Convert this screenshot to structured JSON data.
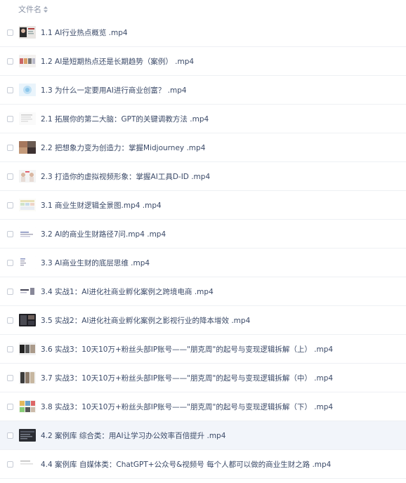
{
  "header": {
    "column_title": "文件名"
  },
  "files": [
    {
      "name": "1.1 AI行业热点概览 .mp4",
      "thumb": "portrait-dark"
    },
    {
      "name": "1.2 AI是短期热点还是长期趋势（案例） .mp4",
      "thumb": "slide-multi"
    },
    {
      "name": "1.3 为什么一定要用AI进行商业创富？ .mp4",
      "thumb": "slide-blue"
    },
    {
      "name": "2.1 拓展你的第二大脑：GPT的关键调教方法 .mp4",
      "thumb": "document"
    },
    {
      "name": "2.2 把想象力变为创造力：掌握Midjourney .mp4",
      "thumb": "photo-collage"
    },
    {
      "name": "2.3 打造你的虚拟视频形象：掌握AI工具D-ID .mp4",
      "thumb": "portrait-pair"
    },
    {
      "name": "3.1 商业生财逻辑全景图.mp4 .mp4",
      "thumb": "grid-chart"
    },
    {
      "name": "3.2 AI的商业生财路径7问.mp4 .mp4",
      "thumb": "text-slide"
    },
    {
      "name": "3.3 AI商业生财的底层思维 .mp4",
      "thumb": "list-slide"
    },
    {
      "name": "3.4 实战1：AI进化社商业孵化案例之跨境电商 .mp4",
      "thumb": "mixed-slide"
    },
    {
      "name": "3.5 实战2：AI进化社商业孵化案例之影视行业的降本增效 .mp4",
      "thumb": "video-dark"
    },
    {
      "name": "3.6 实战3：10天10万+粉丝头部IP账号——\"朋克周\"的起号与变现逻辑拆解（上） .mp4",
      "thumb": "screens-dark"
    },
    {
      "name": "3.7 实战3：10天10万+粉丝头部IP账号——\"朋克周\"的起号与变现逻辑拆解（中） .mp4",
      "thumb": "phones"
    },
    {
      "name": "3.8 实战3：10天10万+粉丝头部IP账号——\"朋克周\"的起号与变现逻辑拆解（下） .mp4",
      "thumb": "color-grid"
    },
    {
      "name": "4.2 案例库 综合类：用AI让学习办公效率百倍提升 .mp4",
      "thumb": "dark-app"
    },
    {
      "name": "4.4 案例库 自媒体类：ChatGPT+公众号&视频号 每个人都可以做的商业生财之路 .mp4",
      "thumb": "white-doc"
    }
  ],
  "active_row_index": 14,
  "colors": {
    "text": "#3b4a68",
    "header_text": "#8a93a6",
    "row_divider": "#eef0f4",
    "active_row": "#f2f5fa"
  }
}
